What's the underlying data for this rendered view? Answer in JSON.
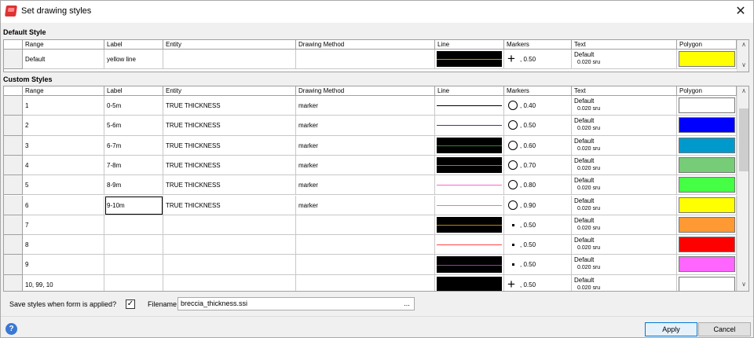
{
  "window": {
    "title": "Set drawing styles",
    "close_glyph": "✕"
  },
  "columns": [
    "Range",
    "Label",
    "Entity",
    "Drawing Method",
    "Line",
    "Markers",
    "Text",
    "Polygon"
  ],
  "default_section": {
    "title": "Default Style",
    "row": {
      "range": "Default",
      "label": "yellow line",
      "entity": "",
      "method": "",
      "line_bg": "#000000",
      "line_color": "#c8a000",
      "marker_icon": "plus-icon",
      "marker_size": ", 0.50",
      "text_font": "Default",
      "text_size": "0.020 sru",
      "poly_color": "#ffff00"
    }
  },
  "custom_section": {
    "title": "Custom Styles",
    "rows": [
      {
        "range": "1",
        "label": "0-5m",
        "entity": "TRUE THICKNESS",
        "method": "marker",
        "line_bg": "#ffffff",
        "line_color": "#000000",
        "marker_icon": "circle-icon",
        "marker_size": ", 0.40",
        "text_font": "Default",
        "text_size": "0.020 sru",
        "poly_color": "#ffffff"
      },
      {
        "range": "2",
        "label": "5-6m",
        "entity": "TRUE THICKNESS",
        "method": "marker",
        "line_bg": "#ffffff",
        "line_color": "#3333cc",
        "marker_icon": "circle-icon",
        "marker_size": ", 0.50",
        "text_font": "Default",
        "text_size": "0.020 sru",
        "poly_color": "#0000ff"
      },
      {
        "range": "3",
        "label": "6-7m",
        "entity": "TRUE THICKNESS",
        "method": "marker",
        "line_bg": "#000000",
        "line_color": "#2f8a2f",
        "marker_icon": "circle-icon",
        "marker_size": ", 0.60",
        "text_font": "Default",
        "text_size": "0.020 sru",
        "poly_color": "#0099cc"
      },
      {
        "range": "4",
        "label": "7-8m",
        "entity": "TRUE THICKNESS",
        "method": "marker",
        "line_bg": "#000000",
        "line_color": "#8a7f2f",
        "marker_icon": "circle-icon",
        "marker_size": ", 0.70",
        "text_font": "Default",
        "text_size": "0.020 sru",
        "poly_color": "#77cc77"
      },
      {
        "range": "5",
        "label": "8-9m",
        "entity": "TRUE THICKNESS",
        "method": "marker",
        "line_bg": "#ffffff",
        "line_color": "#ff66cc",
        "marker_icon": "circle-icon",
        "marker_size": ", 0.80",
        "text_font": "Default",
        "text_size": "0.020 sru",
        "poly_color": "#44ff44"
      },
      {
        "range": "6",
        "label": "9-10m",
        "entity": "TRUE THICKNESS",
        "method": "marker",
        "line_bg": "#ffffff",
        "line_color": "#ff66cc",
        "marker_icon": "circle-icon",
        "marker_size": ", 0.90",
        "text_font": "Default",
        "text_size": "0.020 sru",
        "poly_color": "#ffff00"
      },
      {
        "range": "7",
        "label": "",
        "entity": "",
        "method": "",
        "line_bg": "#000000",
        "line_color": "#c88000",
        "marker_icon": "dot-icon",
        "marker_size": ", 0.50",
        "text_font": "Default",
        "text_size": "0.020 sru",
        "poly_color": "#ff9933"
      },
      {
        "range": "8",
        "label": "",
        "entity": "",
        "method": "",
        "line_bg": "#ffffff",
        "line_color": "#ff4444",
        "marker_icon": "dot-icon",
        "marker_size": ", 0.50",
        "text_font": "Default",
        "text_size": "0.020 sru",
        "poly_color": "#ff0000"
      },
      {
        "range": "9",
        "label": "",
        "entity": "",
        "method": "",
        "line_bg": "#000000",
        "line_color": "#aa33aa",
        "marker_icon": "dot-icon",
        "marker_size": ", 0.50",
        "text_font": "Default",
        "text_size": "0.020 sru",
        "poly_color": "#ff66ff"
      },
      {
        "range": "10, 99, 10",
        "label": "",
        "entity": "",
        "method": "",
        "line_bg": "#000000",
        "line_color": "#000000",
        "marker_icon": "plus-icon",
        "marker_size": ", 0.50",
        "text_font": "Default",
        "text_size": "0.020 sru",
        "poly_color": "#ffffff"
      }
    ]
  },
  "footer": {
    "save_label": "Save styles when form is applied?",
    "save_checked": "✓",
    "filename_label": "Filename",
    "filename_value": "breccia_thickness.ssi",
    "browse_label": "...",
    "help_label": "?",
    "apply_label": "Apply",
    "cancel_label": "Cancel"
  }
}
